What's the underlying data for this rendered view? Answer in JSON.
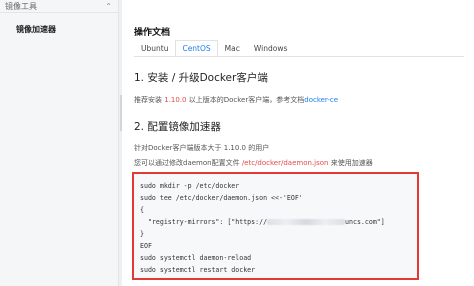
{
  "sidebar": {
    "header": "镜像工具",
    "items": [
      {
        "label": "镜像加速器"
      }
    ]
  },
  "main": {
    "title": "操作文档",
    "tabs": [
      {
        "label": "Ubuntu"
      },
      {
        "label": "CentOS",
        "active": true
      },
      {
        "label": "Mac"
      },
      {
        "label": "Windows"
      }
    ],
    "section1": {
      "heading": "1. 安装 / 升级Docker客户端",
      "para_prefix": "推荐安装 ",
      "para_version": "1.10.0",
      "para_middle": " 以上版本的Docker客户端，参考文档",
      "para_link": "docker-ce"
    },
    "section2": {
      "heading": "2. 配置镜像加速器",
      "para1": "针对Docker客户端版本大于 1.10.0 的用户",
      "para2_prefix": "您可以通过修改daemon配置文件 ",
      "para2_path": "/etc/docker/daemon.json",
      "para2_suffix": " 来使用加速器",
      "code": {
        "line1": "sudo mkdir -p /etc/docker",
        "line2": "sudo tee /etc/docker/daemon.json <<-'EOF'",
        "line3": "{",
        "line4_prefix": "  \"registry-mirrors\": [\"https://",
        "line4_suffix": "uncs.com\"]",
        "line5": "}",
        "line6": "EOF",
        "line7": "sudo systemctl daemon-reload",
        "line8": "sudo systemctl restart docker"
      }
    }
  },
  "colors": {
    "accent": "#1a7ff0",
    "highlight": "#e24b4b",
    "code_border": "#e53935"
  }
}
